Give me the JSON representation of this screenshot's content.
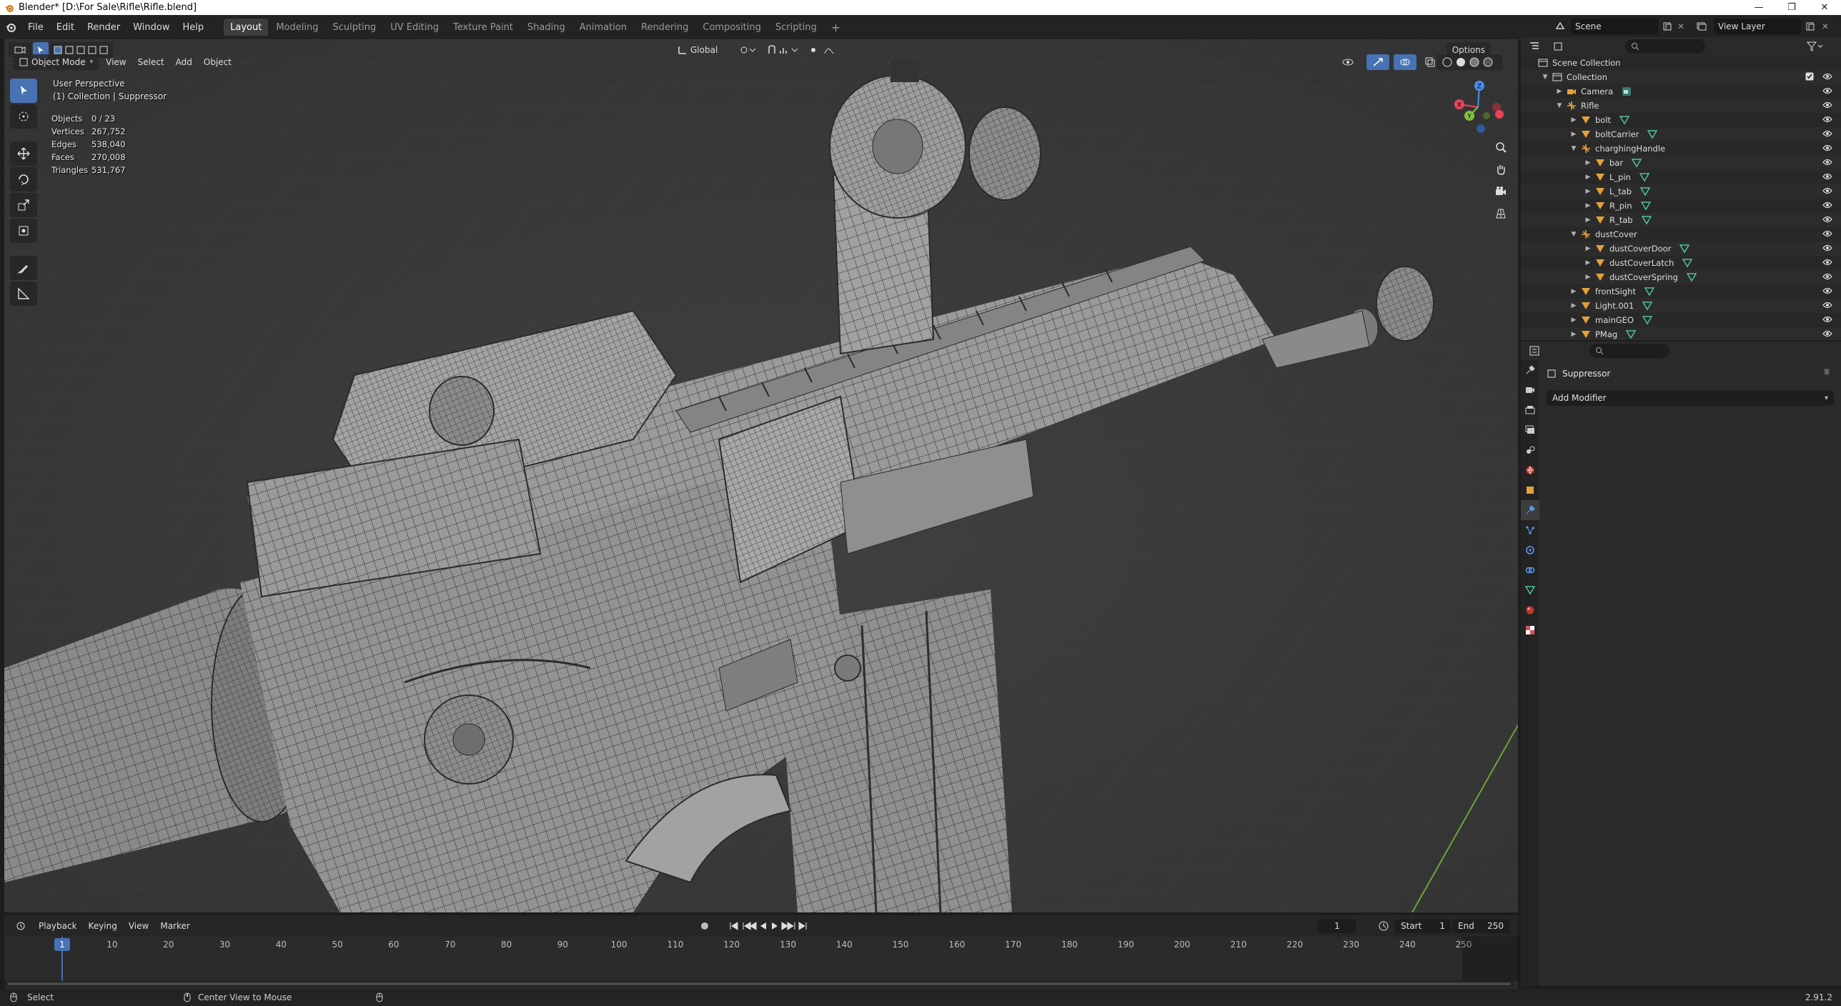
{
  "window": {
    "title": "Blender* [D:\\For Sale\\Rifle\\Rifle.blend]",
    "controls": [
      "—",
      "❐",
      "✕"
    ]
  },
  "menus": [
    "File",
    "Edit",
    "Render",
    "Window",
    "Help"
  ],
  "workspaces": [
    "Layout",
    "Modeling",
    "Sculpting",
    "UV Editing",
    "Texture Paint",
    "Shading",
    "Animation",
    "Rendering",
    "Compositing",
    "Scripting"
  ],
  "active_workspace": "Layout",
  "add_tab_symbol": "+",
  "scene": {
    "label": "Scene",
    "view_layer": "View Layer"
  },
  "viewport": {
    "mode": "Object Mode",
    "menus": [
      "View",
      "Select",
      "Add",
      "Object"
    ],
    "transform_orientation": "Global",
    "options_label": "Options",
    "view_name": "User Perspective",
    "context": "(1) Collection | Suppressor",
    "stats": [
      {
        "label": "Objects",
        "value": "0 / 23"
      },
      {
        "label": "Vertices",
        "value": "267,752"
      },
      {
        "label": "Edges",
        "value": "538,040"
      },
      {
        "label": "Faces",
        "value": "270,008"
      },
      {
        "label": "Triangles",
        "value": "531,767"
      }
    ],
    "gizmo_axes": [
      "X",
      "Y",
      "Z"
    ]
  },
  "timeline": {
    "menus": [
      "Playback",
      "Keying",
      "View",
      "Marker"
    ],
    "current_frame": "1",
    "start_label": "Start",
    "start": "1",
    "end_label": "End",
    "end": "250",
    "ruler": [
      "1",
      "10",
      "20",
      "30",
      "40",
      "50",
      "60",
      "70",
      "80",
      "90",
      "100",
      "110",
      "120",
      "130",
      "140",
      "150",
      "160",
      "170",
      "180",
      "190",
      "200",
      "210",
      "220",
      "230",
      "240",
      "250"
    ]
  },
  "status": {
    "select": "Select",
    "center_view": "Center View to Mouse",
    "version": "2.91.2"
  },
  "outliner": {
    "rows": [
      {
        "label": "Scene Collection",
        "depth": 0,
        "kind": "scene"
      },
      {
        "label": "Collection",
        "depth": 1,
        "kind": "collection"
      },
      {
        "label": "Camera",
        "depth": 2,
        "kind": "camera"
      },
      {
        "label": "Rifle",
        "depth": 2,
        "kind": "empty"
      },
      {
        "label": "bolt",
        "depth": 3,
        "kind": "mesh"
      },
      {
        "label": "boltCarrier",
        "depth": 3,
        "kind": "mesh"
      },
      {
        "label": "charghingHandle",
        "depth": 3,
        "kind": "empty"
      },
      {
        "label": "bar",
        "depth": 4,
        "kind": "mesh"
      },
      {
        "label": "L_pin",
        "depth": 4,
        "kind": "mesh"
      },
      {
        "label": "L_tab",
        "depth": 4,
        "kind": "mesh"
      },
      {
        "label": "R_pin",
        "depth": 4,
        "kind": "mesh"
      },
      {
        "label": "R_tab",
        "depth": 4,
        "kind": "mesh"
      },
      {
        "label": "dustCover",
        "depth": 3,
        "kind": "empty"
      },
      {
        "label": "dustCoverDoor",
        "depth": 4,
        "kind": "mesh"
      },
      {
        "label": "dustCoverLatch",
        "depth": 4,
        "kind": "mesh"
      },
      {
        "label": "dustCoverSpring",
        "depth": 4,
        "kind": "mesh"
      },
      {
        "label": "frontSight",
        "depth": 3,
        "kind": "mesh"
      },
      {
        "label": "Light.001",
        "depth": 3,
        "kind": "mesh"
      },
      {
        "label": "mainGEO",
        "depth": 3,
        "kind": "mesh"
      },
      {
        "label": "PMag",
        "depth": 3,
        "kind": "mesh"
      }
    ]
  },
  "properties": {
    "object_name": "Suppressor",
    "add_modifier": "Add Modifier"
  },
  "colors": {
    "accent": "#4772b3",
    "mesh_icon": "#e3a13c",
    "data_icon": "#4fc1a2",
    "bg_viewport": "#3b3b3b"
  }
}
